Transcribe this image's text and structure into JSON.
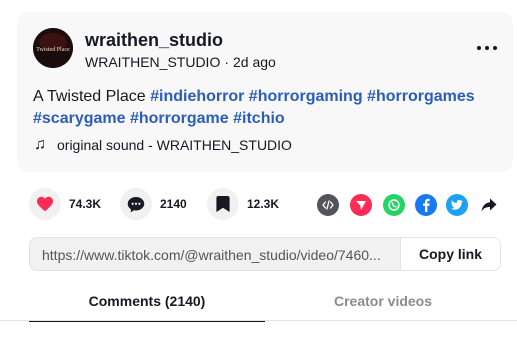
{
  "author": {
    "avatar_text": "Twisted Place",
    "name": "wraithen_studio",
    "handle": "WRAITHEN_STUDIO",
    "separator": "·",
    "time_ago": "2d ago"
  },
  "caption": {
    "text": "A Twisted Place ",
    "hashtags": [
      "#indiehorror",
      "#horrorgaming",
      "#horrorgames",
      "#scarygame",
      "#horrorgame",
      "#itchio"
    ]
  },
  "music": {
    "icon": "music-note-icon",
    "label": "original sound - WRAITHEN_STUDIO"
  },
  "actions": {
    "likes": "74.3K",
    "comments": "2140",
    "saves": "12.3K",
    "like_color": "#fe2c55"
  },
  "share_icons": [
    "embed-icon",
    "send-icon",
    "whatsapp-icon",
    "facebook-icon",
    "twitter-icon",
    "share-arrow-icon"
  ],
  "share_colors": {
    "embed": "#54545a",
    "send": "#fe2c55",
    "whatsapp": "#25d366",
    "facebook": "#1877f2",
    "twitter": "#1da1f2"
  },
  "link": {
    "url": "https://www.tiktok.com/@wraithen_studio/video/7460...",
    "copy_label": "Copy link"
  },
  "tabs": {
    "comments": "Comments (2140)",
    "creator_videos": "Creator videos"
  }
}
